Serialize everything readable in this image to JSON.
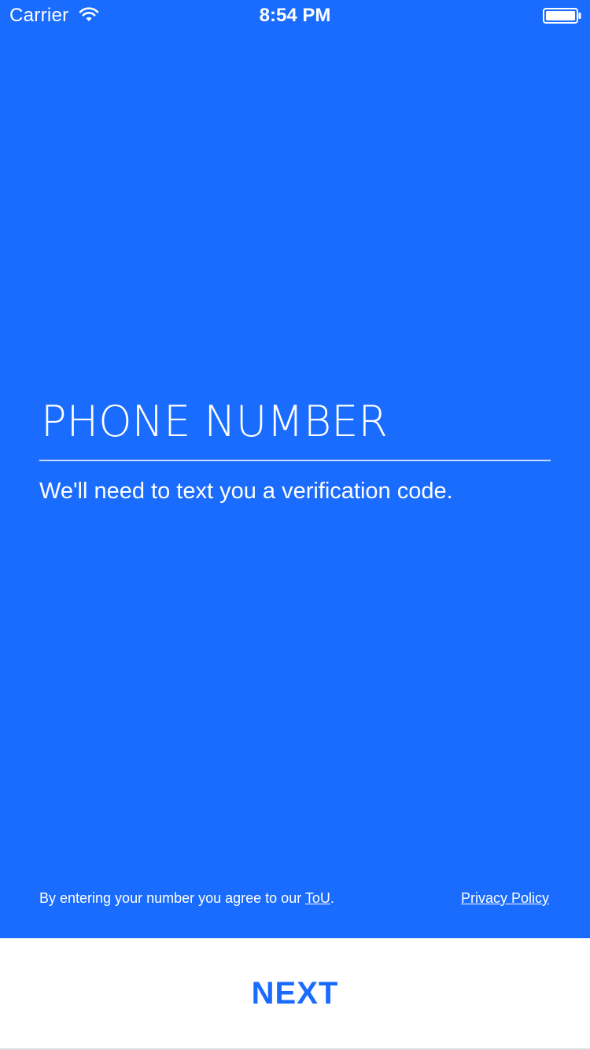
{
  "status_bar": {
    "carrier": "Carrier",
    "time": "8:54 PM",
    "wifi_icon": "wifi-icon",
    "battery_icon": "battery-icon"
  },
  "phone_field": {
    "placeholder": "PHONE NUMBER",
    "value": ""
  },
  "hint": "We'll need to text you a verification code.",
  "terms": {
    "prefix": "By entering your number you agree to our ",
    "tou_link": "ToU",
    "suffix": "."
  },
  "privacy_link": "Privacy Policy",
  "next_button": "NEXT",
  "colors": {
    "background": "#1a6cff",
    "accent": "#1a6cff",
    "text": "#ffffff"
  }
}
